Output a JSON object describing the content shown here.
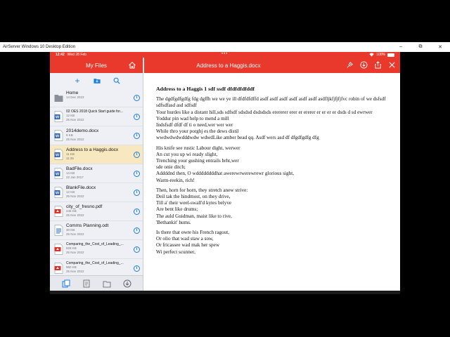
{
  "window": {
    "title": "AirServer Windows 10 Desktop Edition",
    "controls": [
      "–",
      "⧉",
      "✕"
    ]
  },
  "statusbar": {
    "time": "12:42",
    "date": "Wed 28 Feb",
    "dots": "•••",
    "battery": "100%"
  },
  "sidebar": {
    "title": "My Files",
    "files": [
      {
        "name": "Home",
        "sub1": "14 Dec 2023",
        "sub2": "",
        "type": "folder",
        "small": false
      },
      {
        "name": "02 OES 2018 Quick Start guide for...",
        "sub1": "12 KB",
        "sub2": "25 Nov 2022",
        "type": "word",
        "small": true
      },
      {
        "name": "2014demo.docx",
        "sub1": "9 KB",
        "sub2": "25 Nov 2022",
        "type": "word",
        "small": false
      },
      {
        "name": "Address to a Haggis.docx",
        "sub1": "11 KB",
        "sub2": "11:35",
        "type": "word",
        "small": false,
        "selected": true
      },
      {
        "name": "BadFile.docx",
        "sub1": "14 KB",
        "sub2": "22 Jan 2017",
        "type": "word",
        "small": false
      },
      {
        "name": "BlankFile.docx",
        "sub1": "12 KB",
        "sub2": "25 Nov 2022",
        "type": "word",
        "small": false
      },
      {
        "name": "city_of_fresno.pdf",
        "sub1": "246 KB",
        "sub2": "25 Nov 2022",
        "type": "pdf",
        "small": false
      },
      {
        "name": "Comms Planning.odt",
        "sub1": "30 KB",
        "sub2": "25 Nov 2022",
        "type": "odt",
        "small": false
      },
      {
        "name": "Comparing_the_Cost_of_Leading_...",
        "sub1": "929 KB",
        "sub2": "25 Nov 2022",
        "type": "pdf",
        "small": true
      },
      {
        "name": "Comparing_the_Cost_of_Leading_...",
        "sub1": "960 KB",
        "sub2": "25 Nov 2022",
        "type": "pdf",
        "small": true
      }
    ]
  },
  "document": {
    "title": "Address to a Haggis.docx",
    "heading": "Address to a Haggis 1 sdf ssdf dfdfdfdfddf",
    "paragraphs": [
      [
        {
          "text": "The dgdfgdfgdfg fdg dgffh  we we ye ill dfdfdfdffd asdf asdf asdf asdf asdf asdf asdfljkfjfjfjfvc robin  of we dsfsdf sdfsdfasd asd sdfsdf",
          "wrap": true
        },
        {
          "text": "Your hurdes like a distant hill,sds sdfsdf sdsdsd dsdsdsds erererer erer er ererer er er er er dsds d sd ewrwer",
          "wrap": true
        },
        {
          "text": "Yoddur pin wad help to mend a mill",
          "wrap": false
        },
        {
          "text": "Indsfsdf dfdf df ti o need,wer wer wer",
          "wrap": false
        },
        {
          "text": "While thro your porghj es the dews distil",
          "wrap": false
        },
        {
          "text": "wwdwdwdwdddwdw wdwdLike amber bead qq.  Asdf  wers asd df dfgdfgdfg dfg",
          "wrap": false
        }
      ],
      [
        {
          "text": "His knife see rustic Labour dight, werwer",
          "wrap": false
        },
        {
          "text": "An cut you up wi ready slight,",
          "wrap": false
        },
        {
          "text": "Trenching your gushing entrails brht,wer",
          "wrap": false
        },
        {
          "text": "sde onie ditch;",
          "wrap": false
        },
        {
          "text": "Addddnd then, O wddddddddhat awerewrwerewrewr glorious sight,",
          "wrap": false
        },
        {
          "text": "Warm-reekin, rich!",
          "wrap": false
        }
      ],
      [
        {
          "text": "Then, horn for horn, they stretch anew strive:",
          "wrap": false
        },
        {
          "text": "Deil tak the hindmost, on they drive,",
          "wrap": false
        },
        {
          "text": "Till a' their weel-swall'd kytes belyve",
          "wrap": false
        },
        {
          "text": "Are bent like drums;",
          "wrap": false
        },
        {
          "text": "The auld Guidman, maist like to rive,",
          "wrap": false
        },
        {
          "text": "'Bethankit' hums.",
          "wrap": false
        }
      ],
      [
        {
          "text": "Is there that owre his French ragout,",
          "wrap": false
        },
        {
          "text": "Or olio that wad staw a sow,",
          "wrap": false
        },
        {
          "text": "Or fricassee wad mak her spew",
          "wrap": false
        },
        {
          "text": "Wi perfect scunner,",
          "wrap": false
        }
      ]
    ]
  }
}
